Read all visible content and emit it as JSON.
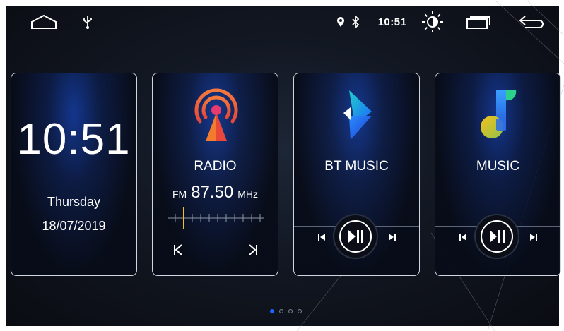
{
  "status_bar": {
    "time": "10:51",
    "icons": [
      "home-icon",
      "usb-icon",
      "location-icon",
      "bluetooth-icon",
      "brightness-icon",
      "recent-apps-icon",
      "back-icon"
    ]
  },
  "clock_card": {
    "time": "10:51",
    "day": "Thursday",
    "date": "18/07/2019"
  },
  "radio_card": {
    "title": "RADIO",
    "band": "FM",
    "frequency": "87.50",
    "unit": "MHz",
    "icons": [
      "radio-tower-icon",
      "prev-station-icon",
      "next-station-icon"
    ]
  },
  "bt_music_card": {
    "title": "BT MUSIC",
    "icons": [
      "bt-music-logo-icon",
      "previous-track-icon",
      "play-pause-icon",
      "next-track-icon"
    ]
  },
  "music_card": {
    "title": "MUSIC",
    "icons": [
      "music-note-logo-icon",
      "previous-track-icon",
      "play-pause-icon",
      "next-track-icon"
    ]
  },
  "page_indicator": {
    "pages": 4,
    "active": 1
  },
  "colors": {
    "accent_blue": "#1e64ff",
    "radio_orange": "#f26b3a",
    "tuner_marker": "#f2c21a",
    "border": "#cfd6e0"
  }
}
